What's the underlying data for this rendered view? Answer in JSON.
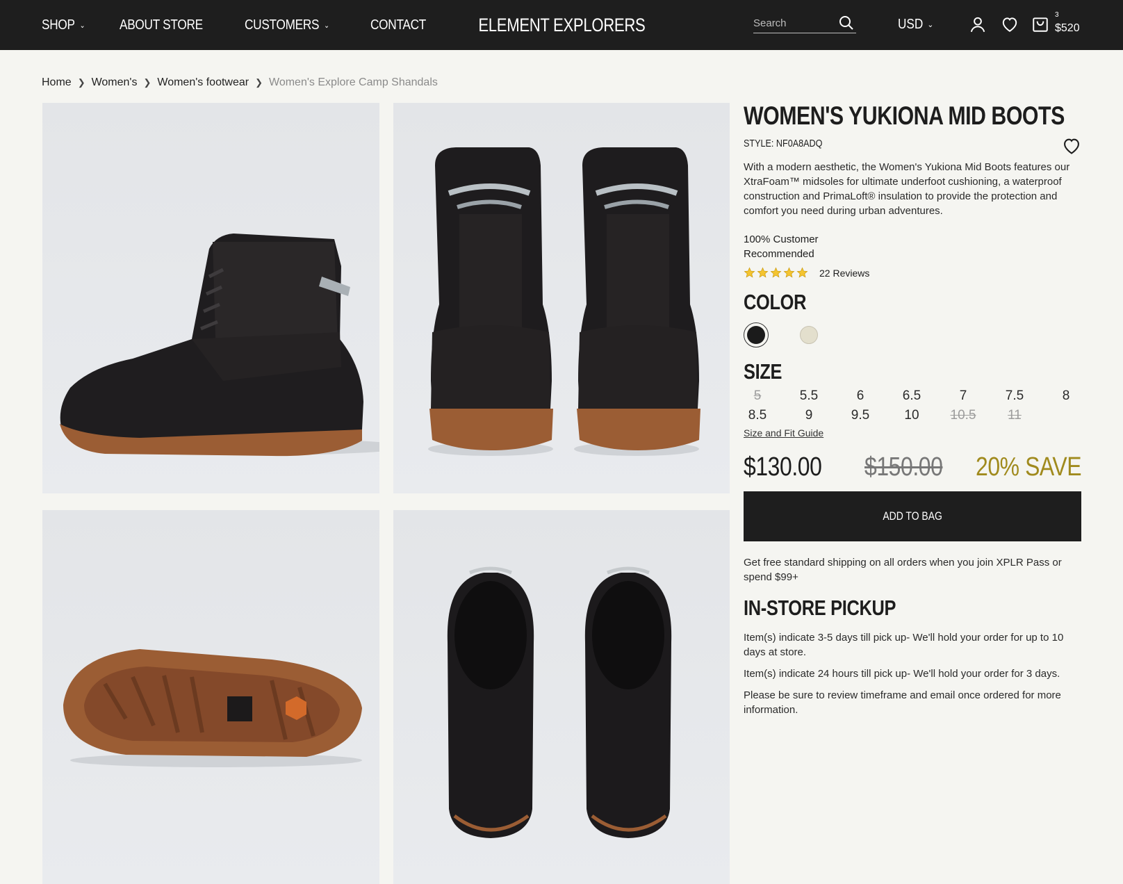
{
  "header": {
    "nav": [
      {
        "label": "SHOP",
        "has_dropdown": true
      },
      {
        "label": "ABOUT STORE",
        "has_dropdown": false
      },
      {
        "label": "CUSTOMERS",
        "has_dropdown": true
      },
      {
        "label": "CONTACT",
        "has_dropdown": false
      }
    ],
    "brand": "ELEMENT EXPLORERS",
    "search_placeholder": "Search",
    "currency": "USD",
    "cart_count": "3",
    "cart_total": "$520"
  },
  "breadcrumb": [
    "Home",
    "Women's",
    "Women's footwear",
    "Women's Explore Camp Shandals"
  ],
  "gallery": [
    {
      "icon": "boot-side-view-image"
    },
    {
      "icon": "boots-back-view-image"
    },
    {
      "icon": "boot-sole-view-image"
    },
    {
      "icon": "boots-top-view-image"
    }
  ],
  "product": {
    "title": "WOMEN'S YUKIONA MID BOOTS",
    "style": "STYLE: NF0A8ADQ",
    "description": "With a modern aesthetic, the Women's Yukiona Mid Boots features our XtraFoam™ midsoles for ultimate underfoot cushioning, a waterproof construction and PrimaLoft® insulation to provide the protection and comfort you need during urban adventures.",
    "recommendation": "100% Customer Recommended",
    "rating_stars": 5,
    "reviews": "22 Reviews",
    "color_heading": "COLOR",
    "colors": [
      {
        "name": "black",
        "hex": "#1b1b1b",
        "selected": true
      },
      {
        "name": "cream",
        "hex": "#e3dfcd",
        "selected": false
      }
    ],
    "size_heading": "SIZE",
    "sizes": [
      {
        "label": "5",
        "available": false
      },
      {
        "label": "5.5",
        "available": true
      },
      {
        "label": "6",
        "available": true
      },
      {
        "label": "6.5",
        "available": true
      },
      {
        "label": "7",
        "available": true
      },
      {
        "label": "7.5",
        "available": true
      },
      {
        "label": "8",
        "available": true
      },
      {
        "label": "8.5",
        "available": true
      },
      {
        "label": "9",
        "available": true
      },
      {
        "label": "9.5",
        "available": true
      },
      {
        "label": "10",
        "available": true
      },
      {
        "label": "10.5",
        "available": false
      },
      {
        "label": "11",
        "available": false
      }
    ],
    "size_guide": "Size and Fit Guide",
    "price": "$130.00",
    "old_price": "$150.00",
    "save": "20% SAVE",
    "add_to_bag": "ADD TO BAG",
    "shipping": "Get free standard shipping on all orders when you join XPLR Pass or spend $99+",
    "pickup_heading": "IN-STORE PICKUP",
    "pickup_notes": [
      "Item(s) indicate 3-5 days till pick up- We'll hold your order for up to 10 days at store.",
      "Item(s) indicate 24 hours till pick up- We'll hold your order for 3 days.",
      "Please be sure to review timeframe and email once ordered for more information."
    ]
  },
  "colors": {
    "header_bg": "#1e1e1e",
    "page_bg": "#f5f5f1",
    "save_accent": "#a08a1d",
    "star": "#f4c430"
  }
}
